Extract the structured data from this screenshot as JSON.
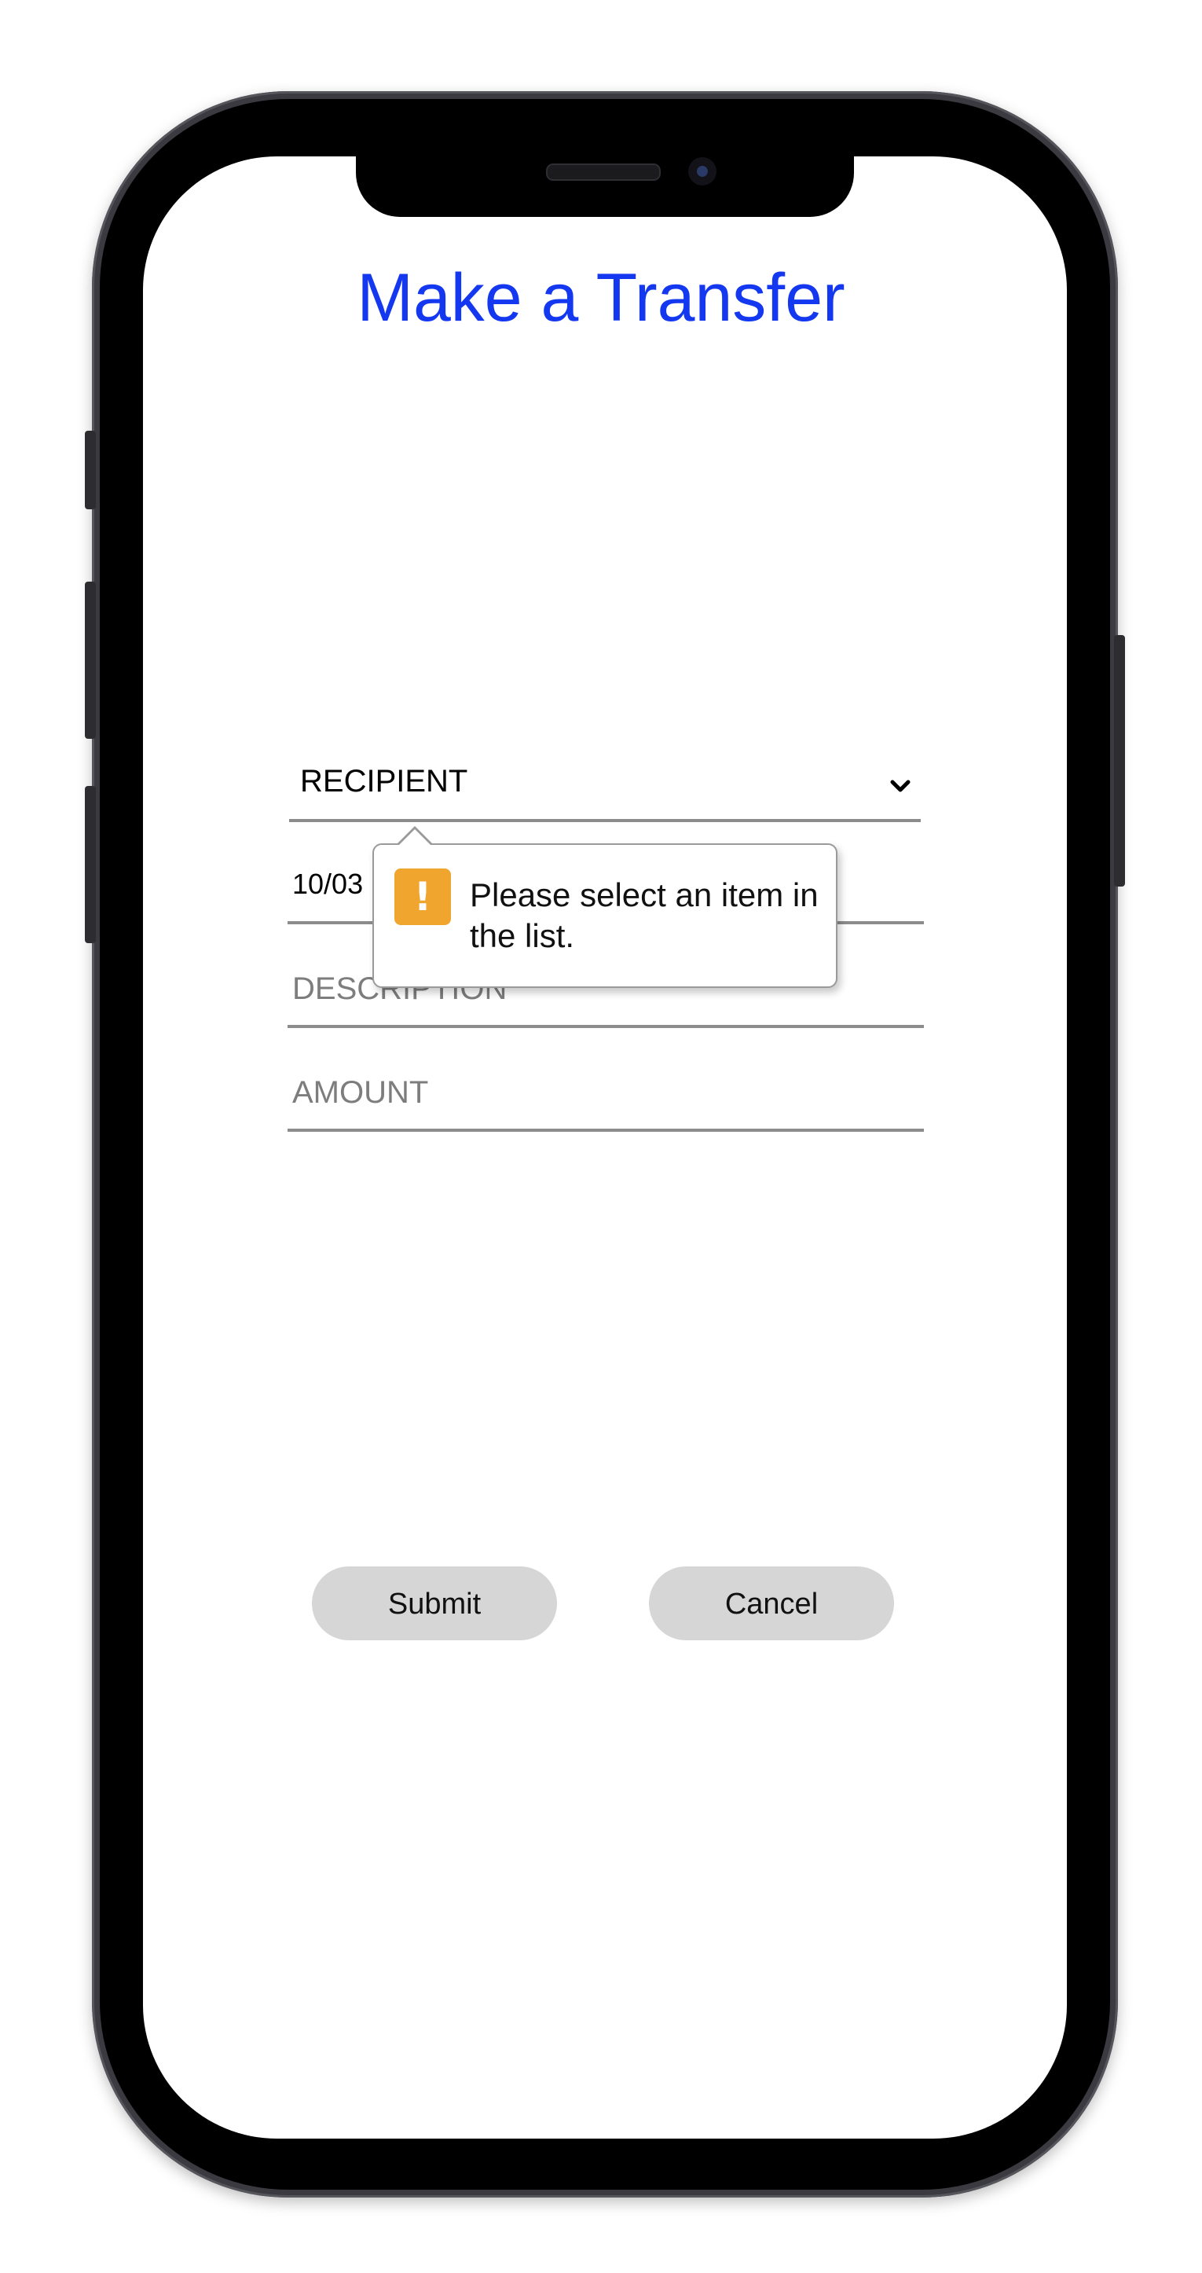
{
  "page": {
    "title": "Make a Transfer"
  },
  "form": {
    "recipient": {
      "selected_label": "RECIPIENT"
    },
    "date": {
      "value": "10/03"
    },
    "description": {
      "placeholder": "DESCRIPTION"
    },
    "amount": {
      "placeholder": "AMOUNT"
    }
  },
  "validation": {
    "message": "Please select an item in the list.",
    "icon": "exclamation-warning-icon",
    "icon_glyph": "!",
    "icon_color": "#f0a52f"
  },
  "actions": {
    "submit_label": "Submit",
    "cancel_label": "Cancel"
  },
  "colors": {
    "title": "#1438f0",
    "button_bg": "#d6d6d6"
  }
}
